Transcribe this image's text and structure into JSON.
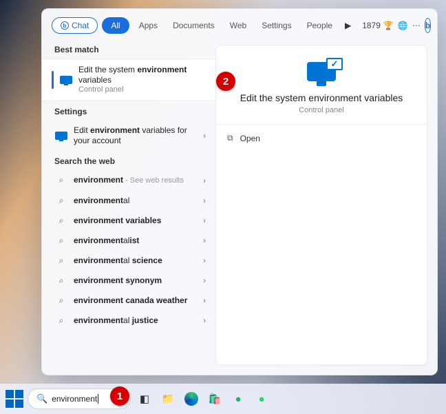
{
  "tabs": {
    "chat": "Chat",
    "all": "All",
    "items": [
      "Apps",
      "Documents",
      "Web",
      "Settings",
      "People"
    ]
  },
  "rewards": {
    "points": "1879"
  },
  "sections": {
    "best_match": "Best match",
    "settings": "Settings",
    "web": "Search the web"
  },
  "best": {
    "pre": "Edit the system ",
    "bold": "environment",
    "post": " variables",
    "sub": "Control panel"
  },
  "settings_item": {
    "pre": "Edit ",
    "bold": "environment",
    "post": " variables for your account"
  },
  "web_items": [
    {
      "pre": "",
      "bold": "environment",
      "post": "",
      "hint": " - See web results"
    },
    {
      "pre": "",
      "bold": "environment",
      "post": "al",
      "hint": ""
    },
    {
      "pre": "",
      "bold": "environment",
      "post": " ",
      "post2": "variables",
      "hint": ""
    },
    {
      "pre": "",
      "bold": "environment",
      "post": "al",
      "post2": "ist",
      "hint": ""
    },
    {
      "pre": "",
      "bold": "environment",
      "post": "al ",
      "post2": "science",
      "hint": ""
    },
    {
      "pre": "",
      "bold": "environment",
      "post": " ",
      "post2": "synonym",
      "hint": ""
    },
    {
      "pre": "",
      "bold": "environment",
      "post": " ",
      "post2": "canada weather",
      "hint": ""
    },
    {
      "pre": "",
      "bold": "environment",
      "post": "al ",
      "post2": "justice",
      "hint": ""
    }
  ],
  "preview": {
    "title": "Edit the system environment variables",
    "sub": "Control panel",
    "open": "Open"
  },
  "annotations": {
    "step1": "1",
    "step2": "2"
  },
  "search": {
    "query": "environment"
  }
}
